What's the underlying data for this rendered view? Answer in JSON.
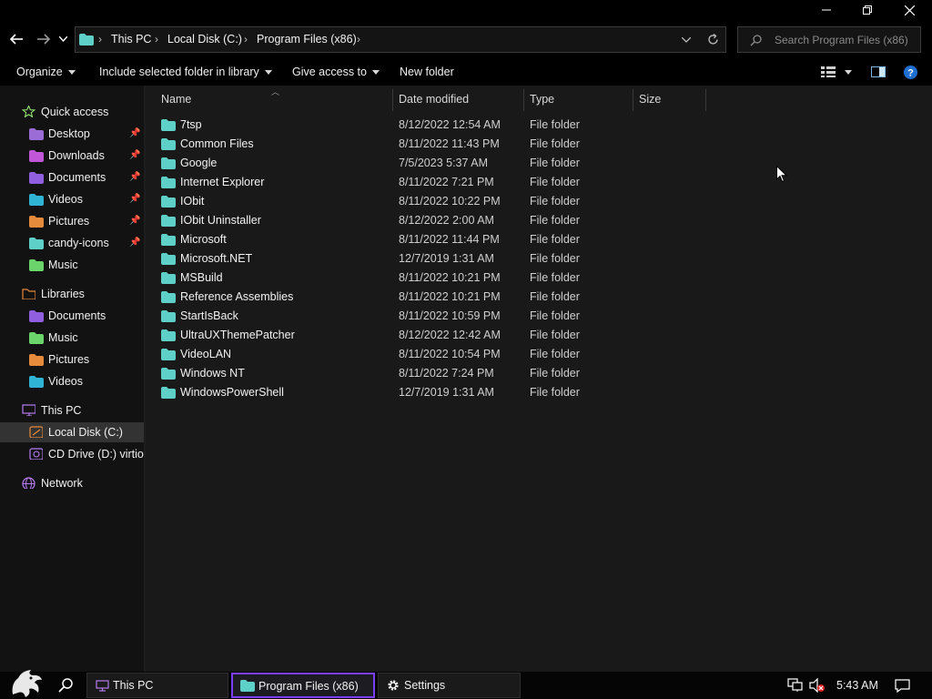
{
  "window": {
    "minimize_icon": "minimize-icon",
    "restore_icon": "restore-icon",
    "close_icon": "close-icon"
  },
  "address": {
    "crumbs": [
      "This PC",
      "Local Disk (C:)",
      "Program Files (x86)"
    ],
    "search_placeholder": "Search Program Files (x86)"
  },
  "toolbar": {
    "organize": "Organize",
    "include": "Include selected folder in library",
    "give_access": "Give access to",
    "new_folder": "New folder"
  },
  "sidebar": {
    "quick_access": "Quick access",
    "quick_items": [
      {
        "label": "Desktop",
        "icon": "desktop-folder-icon",
        "color": "#9b6bd6"
      },
      {
        "label": "Downloads",
        "icon": "downloads-folder-icon",
        "color": "#c256d8"
      },
      {
        "label": "Documents",
        "icon": "documents-folder-icon",
        "color": "#8f5fe0"
      },
      {
        "label": "Videos",
        "icon": "videos-folder-icon",
        "color": "#2fb4d6"
      },
      {
        "label": "Pictures",
        "icon": "pictures-folder-icon",
        "color": "#e68a3c"
      },
      {
        "label": "candy-icons",
        "icon": "folder-icon",
        "color": "#5fd0c8"
      },
      {
        "label": "Music",
        "icon": "music-folder-icon",
        "color": "#6bd46a"
      }
    ],
    "libraries": "Libraries",
    "library_items": [
      {
        "label": "Documents",
        "icon": "documents-folder-icon",
        "color": "#8f5fe0"
      },
      {
        "label": "Music",
        "icon": "music-folder-icon",
        "color": "#6bd46a"
      },
      {
        "label": "Pictures",
        "icon": "pictures-folder-icon",
        "color": "#e68a3c"
      },
      {
        "label": "Videos",
        "icon": "videos-folder-icon",
        "color": "#2fb4d6"
      }
    ],
    "this_pc": "This PC",
    "local_disk": "Local Disk (C:)",
    "cd_drive": "CD Drive (D:) virtio-",
    "network": "Network"
  },
  "columns": {
    "name": "Name",
    "date": "Date modified",
    "type": "Type",
    "size": "Size"
  },
  "files": [
    {
      "name": "7tsp",
      "date": "8/12/2022 12:54 AM",
      "type": "File folder"
    },
    {
      "name": "Common Files",
      "date": "8/11/2022 11:43 PM",
      "type": "File folder"
    },
    {
      "name": "Google",
      "date": "7/5/2023 5:37 AM",
      "type": "File folder"
    },
    {
      "name": "Internet Explorer",
      "date": "8/11/2022 7:21 PM",
      "type": "File folder"
    },
    {
      "name": "IObit",
      "date": "8/11/2022 10:22 PM",
      "type": "File folder"
    },
    {
      "name": "IObit Uninstaller",
      "date": "8/12/2022 2:00 AM",
      "type": "File folder"
    },
    {
      "name": "Microsoft",
      "date": "8/11/2022 11:44 PM",
      "type": "File folder"
    },
    {
      "name": "Microsoft.NET",
      "date": "12/7/2019 1:31 AM",
      "type": "File folder"
    },
    {
      "name": "MSBuild",
      "date": "8/11/2022 10:21 PM",
      "type": "File folder"
    },
    {
      "name": "Reference Assemblies",
      "date": "8/11/2022 10:21 PM",
      "type": "File folder"
    },
    {
      "name": "StartIsBack",
      "date": "8/11/2022 10:59 PM",
      "type": "File folder"
    },
    {
      "name": "UltraUXThemePatcher",
      "date": "8/12/2022 12:42 AM",
      "type": "File folder"
    },
    {
      "name": "VideoLAN",
      "date": "8/11/2022 10:54 PM",
      "type": "File folder"
    },
    {
      "name": "Windows NT",
      "date": "8/11/2022 7:24 PM",
      "type": "File folder"
    },
    {
      "name": "WindowsPowerShell",
      "date": "12/7/2019 1:31 AM",
      "type": "File folder"
    }
  ],
  "taskbar": {
    "items": [
      "This PC",
      "Program Files (x86)",
      "Settings"
    ],
    "clock": "5:43 AM"
  },
  "colors": {
    "folder": "#5fd0c8",
    "accent": "#7b3df6"
  }
}
